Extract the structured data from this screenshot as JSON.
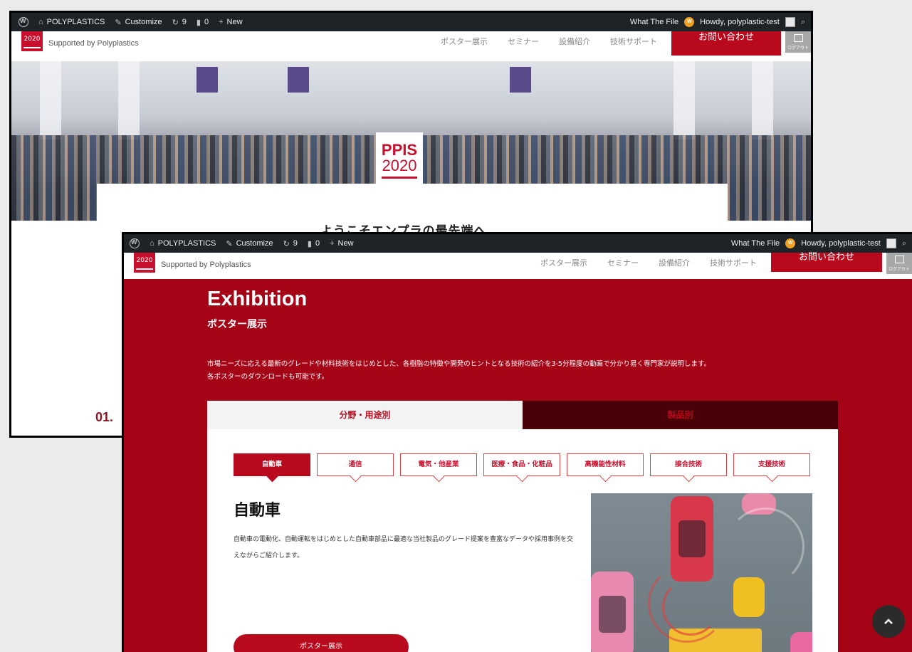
{
  "admin_bar": {
    "site_label": "POLYPLASTICS",
    "customize_label": "Customize",
    "updates_count": "9",
    "comments_count": "0",
    "new_label": "New",
    "what_the_file_label": "What The File",
    "howdy_label": "Howdy, polyplastic-test",
    "icons": [
      "wordpress-logo-icon",
      "dashboard-icon",
      "brush-icon",
      "refresh-icon",
      "comment-icon",
      "plus-icon",
      "search-icon"
    ]
  },
  "header": {
    "logo_text": "2020",
    "tagline": "Supported by Polyplastics",
    "nav": [
      "ポスター展示",
      "セミナー",
      "設備紹介",
      "技術サポート"
    ],
    "contact_label": "お問い合わせ",
    "logout_label": "ログアウト"
  },
  "window1": {
    "badge_line1": "PPIS",
    "badge_line2": "2020",
    "welcome_text": "ようこそエンプラの最先端へ",
    "section_number": "01."
  },
  "exhibition": {
    "title": "Exhibition",
    "subtitle": "ポスター展示",
    "description_line1": "市場ニーズに応える最新のグレードや材料技術をはじめとした、各樹脂の特徴や開発のヒントとなる技術の紹介を3-5分程度の動画で分かり易く専門家が説明します。",
    "description_line2": "各ポスターのダウンロードも可能です。",
    "tabs": [
      {
        "label": "分野・用途別",
        "active": true
      },
      {
        "label": "製品別",
        "active": false
      }
    ],
    "subtabs": [
      {
        "label": "自動車",
        "active": true
      },
      {
        "label": "通信",
        "active": false
      },
      {
        "label": "電気・他産業",
        "active": false
      },
      {
        "label": "医療・食品・化粧品",
        "active": false
      },
      {
        "label": "高機能性材料",
        "active": false
      },
      {
        "label": "接合技術",
        "active": false
      },
      {
        "label": "支援技術",
        "active": false
      }
    ],
    "category_title": "自動車",
    "category_description": "自動車の電動化、自動運転をはじめとした自動車部品に最適な当社製品のグレード提案を豊富なデータや採用事例を交えながらご紹介します。",
    "poster_button_label": "ポスター展示"
  },
  "colors": {
    "brand_red": "#b8091d",
    "exhibition_bg": "#a50417",
    "admin_bar_bg": "#1d2327"
  }
}
